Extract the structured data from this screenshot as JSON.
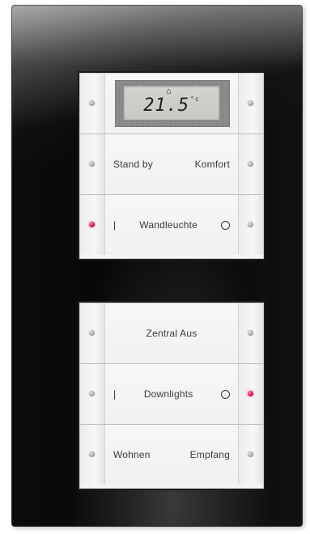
{
  "display": {
    "temperature": "21.5",
    "unit": "°c",
    "mode_icon": "home-icon"
  },
  "top_module": {
    "rows": [
      {
        "left_label": "Stand by",
        "right_label": "Komfort"
      },
      {
        "label": "Wandleuchte",
        "left_mark": "|",
        "right_mark": "○"
      }
    ]
  },
  "bottom_module": {
    "rows": [
      {
        "label": "Zentral Aus"
      },
      {
        "label": "Downlights",
        "left_mark": "|",
        "right_mark": "○"
      },
      {
        "left_label": "Wohnen",
        "right_label": "Empfang"
      }
    ]
  },
  "leds": {
    "active_color": "#e0104e",
    "inactive_color": "#a9a9a9"
  }
}
